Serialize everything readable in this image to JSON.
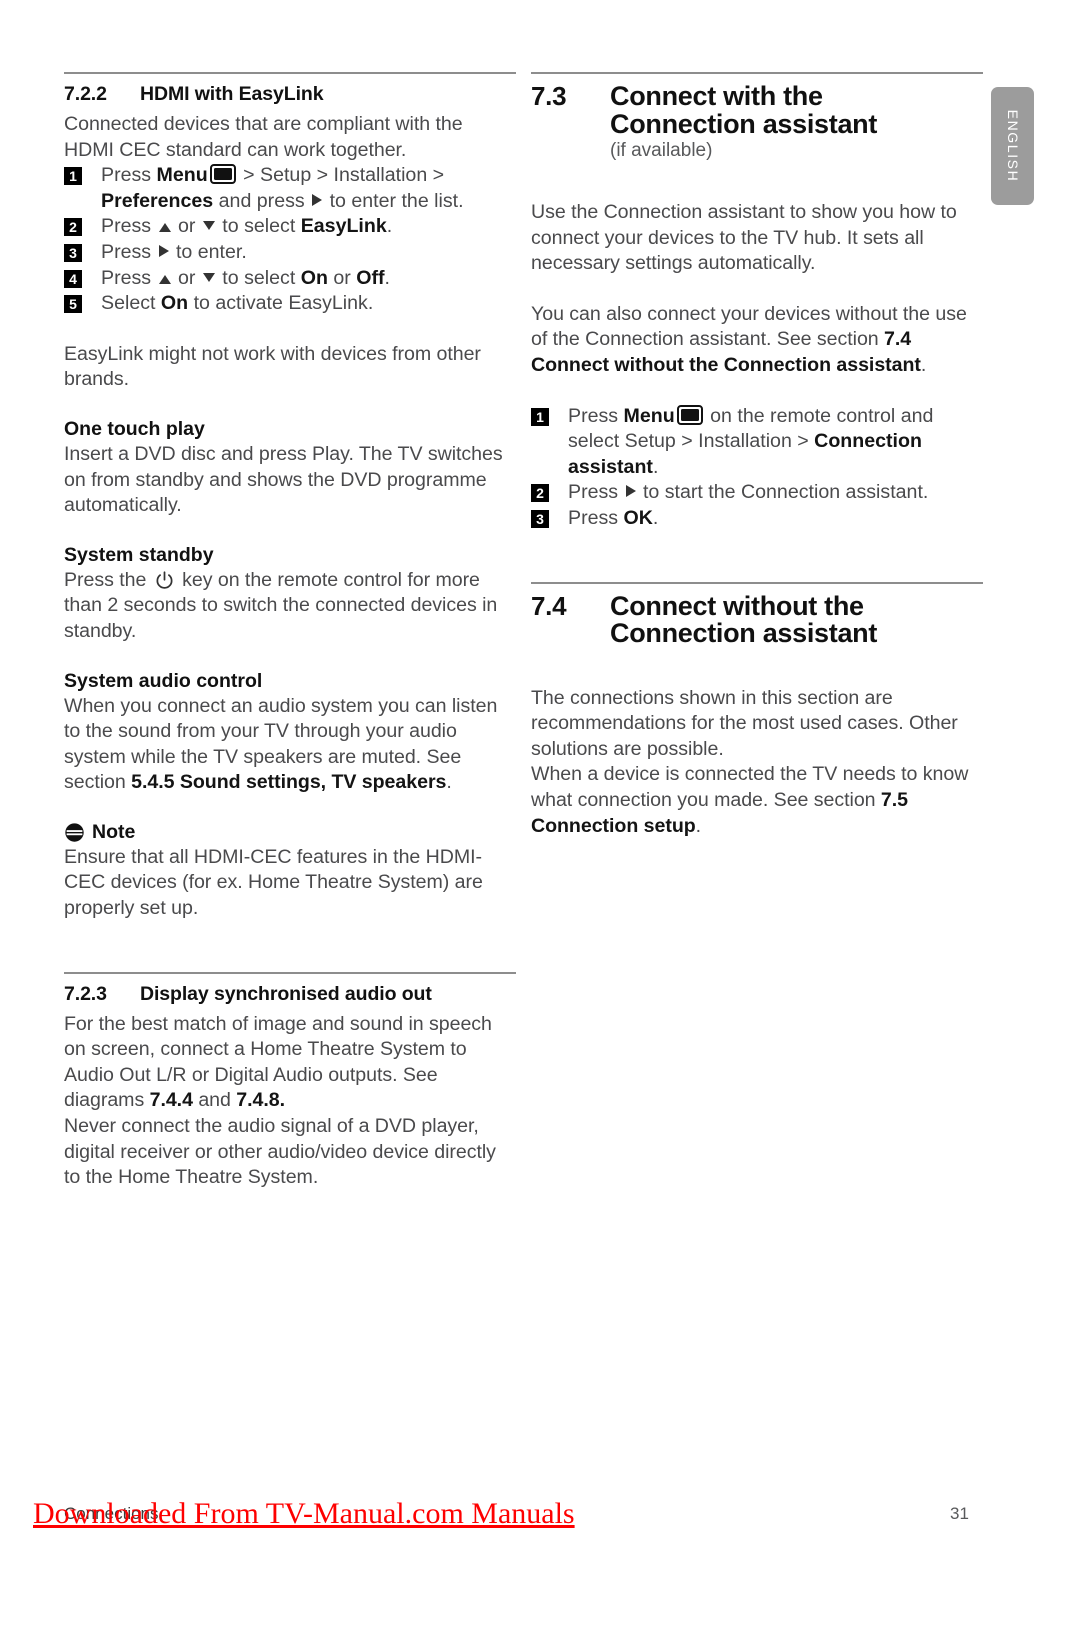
{
  "language_tab": {
    "label": "ENGLISH"
  },
  "footer": {
    "chapter": "Connections",
    "page_number": "31",
    "watermark": "Downloaded From TV-Manual.com Manuals"
  },
  "left_column": {
    "section_722": {
      "number": "7.2.2",
      "title": "HDMI with EasyLink",
      "intro": "Connected devices that are compliant with the HDMI CEC standard can work together.",
      "steps": [
        {
          "badge": "1",
          "part1": "Press ",
          "bold1": "Menu",
          "icon": "menu-icon",
          "part2": " > Setup > Installation > ",
          "bold2": "Preferences",
          "part3": " and press ",
          "icon2": "arrow-right-icon",
          "part4": " to enter the list."
        },
        {
          "badge": "2",
          "part1": "Press ",
          "icon": "arrow-up-icon",
          "part2": " or ",
          "icon2": "arrow-down-icon",
          "part3": " to select ",
          "bold1": "EasyLink",
          "part4": "."
        },
        {
          "badge": "3",
          "part1": "Press ",
          "icon": "arrow-right-icon",
          "part2": " to enter."
        },
        {
          "badge": "4",
          "part1": "Press ",
          "icon": "arrow-up-icon",
          "part2": " or ",
          "icon2": "arrow-down-icon",
          "part3": " to select ",
          "bold1": "On",
          "part4": " or ",
          "bold2": "Off",
          "part5": "."
        },
        {
          "badge": "5",
          "part1": "Select ",
          "bold1": "On",
          "part2": " to activate EasyLink."
        }
      ],
      "note_after_steps": "EasyLink might not work with devices from other brands."
    },
    "one_touch_play": {
      "heading": "One touch play",
      "body": "Insert a DVD disc and press Play. The TV switches on from standby and shows the DVD programme automatically."
    },
    "system_standby": {
      "heading": "System standby",
      "body_before": "Press the ",
      "icon": "power-icon",
      "body_after": " key on the remote control for more than 2 seconds to switch the connected devices in standby."
    },
    "system_audio_control": {
      "heading": "System audio control",
      "body_before": "When you connect an audio system you can listen to the sound from your TV through your audio system while the TV speakers are muted. See section ",
      "bold": "5.4.5 Sound settings, TV speakers",
      "body_after": "."
    },
    "note": {
      "icon": "note-icon",
      "label": "Note",
      "body": "Ensure that all HDMI-CEC features in the HDMI-CEC devices (for ex. Home Theatre System) are properly set up."
    },
    "section_723": {
      "number": "7.2.3",
      "title": "Display synchronised audio out",
      "para1_before": "For the best match of image and sound in speech on screen, connect a Home Theatre System to Audio Out L/R or Digital Audio outputs. See diagrams ",
      "para1_bold1": "7.4.4",
      "para1_mid": " and ",
      "para1_bold2": "7.4.8.",
      "para2": "Never connect the audio signal of a DVD player, digital receiver or other audio/video device directly to the Home Theatre System."
    }
  },
  "right_column": {
    "section_73": {
      "number": "7.3",
      "title_line1": "Connect with the",
      "title_line2": "Connection assistant",
      "subtitle": "(if available)",
      "para1": "Use the Connection assistant to show you how to connect your devices to the TV hub. It sets all necessary settings automatically.",
      "para2_before": "You can also connect your devices without the use of the Connection assistant. See section ",
      "para2_bold1": "7.4",
      "para2_bold2": "Connect without the Connection assistant",
      "para2_after": ".",
      "steps": [
        {
          "badge": "1",
          "part1": "Press ",
          "bold1": "Menu",
          "icon": "menu-icon",
          "part2": " on the remote control and select Setup > Installation > ",
          "bold2": "Connection assistant",
          "part3": "."
        },
        {
          "badge": "2",
          "part1": "Press ",
          "icon": "arrow-right-icon",
          "part2": " to start the Connection assistant."
        },
        {
          "badge": "3",
          "part1": "Press ",
          "bold1": "OK",
          "part2": "."
        }
      ]
    },
    "section_74": {
      "number": "7.4",
      "title_line1": "Connect without the",
      "title_line2": "Connection assistant",
      "para1": "The connections shown in this section are recommendations for the most used cases. Other solutions are possible.",
      "para2_before": "When a device is connected the TV needs to know what connection you made. See section ",
      "para2_bold1": "7.5",
      "para2_bold2": "Connection setup",
      "para2_after": "."
    }
  }
}
